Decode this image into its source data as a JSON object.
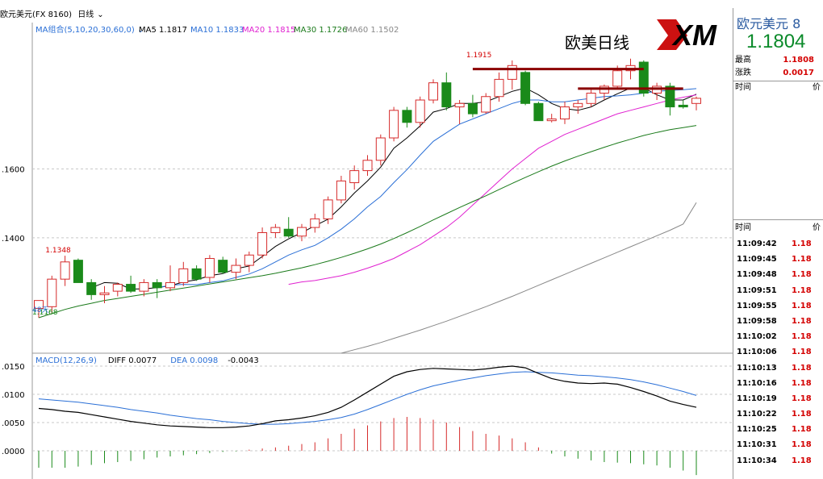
{
  "header": {
    "symbol": "欧元美元(FX 8160)",
    "period": "日线",
    "period_icon": "chevron-down"
  },
  "ma_legend": {
    "label": "MA组合(5,10,20,30,60,0)",
    "items": [
      {
        "name": "MA5",
        "value": "1.1817",
        "color": "#000000"
      },
      {
        "name": "MA10",
        "value": "1.1833",
        "color": "#2a6fd6"
      },
      {
        "name": "MA20",
        "value": "1.1815",
        "color": "#e020d0"
      },
      {
        "name": "MA30",
        "value": "1.1726",
        "color": "#1a7a1a"
      },
      {
        "name": "MA60",
        "value": "1.1502",
        "color": "#888888"
      }
    ]
  },
  "macd_legend": {
    "label": "MACD(12,26,9)",
    "diff": "DIFF 0.0077",
    "dea": "DEA 0.0098",
    "macd": "-0.0043"
  },
  "overlay_title": "欧美日线",
  "logo_text": "XM",
  "right_panel": {
    "title": "欧元美元 8",
    "price": "1.1804",
    "high_label": "最高",
    "high_value": "1.1808",
    "change_label": "涨跌",
    "change_value": "0.0017",
    "col_time": "时间",
    "col_price": "价",
    "ticks": [
      {
        "time": "11:09:42",
        "price": "1.18"
      },
      {
        "time": "11:09:45",
        "price": "1.18"
      },
      {
        "time": "11:09:48",
        "price": "1.18"
      },
      {
        "time": "11:09:51",
        "price": "1.18"
      },
      {
        "time": "11:09:55",
        "price": "1.18"
      },
      {
        "time": "11:09:58",
        "price": "1.18"
      },
      {
        "time": "11:10:02",
        "price": "1.18"
      },
      {
        "time": "11:10:06",
        "price": "1.18"
      },
      {
        "time": "11:10:13",
        "price": "1.18"
      },
      {
        "time": "11:10:16",
        "price": "1.18"
      },
      {
        "time": "11:10:19",
        "price": "1.18"
      },
      {
        "time": "11:10:22",
        "price": "1.18"
      },
      {
        "time": "11:10:25",
        "price": "1.18"
      },
      {
        "time": "11:10:31",
        "price": "1.18"
      },
      {
        "time": "11:10:34",
        "price": "1.18"
      }
    ]
  },
  "chart_data": {
    "type": "candlestick",
    "colors": {
      "up": "#d62b2b",
      "down": "#1a8a1a",
      "resistance": "#8b0000",
      "grid": "#c8c8c8"
    },
    "price_axis": {
      "ticks": [
        1.16,
        1.14
      ],
      "tick_labels": [
        ".1600",
        ".1400"
      ],
      "ylim": [
        1.1065,
        1.1985
      ]
    },
    "macd_axis": {
      "ticks": [
        0.015,
        0.01,
        0.005,
        0.0
      ],
      "tick_labels": [
        ".0150",
        ".0100",
        ".0050",
        ".0000"
      ],
      "ylim": [
        -0.005,
        0.017
      ]
    },
    "annotations": [
      {
        "text": "1.1348",
        "value": 1.1348,
        "index": 1
      },
      {
        "text": "1.1915",
        "value": 1.1915,
        "index": 33
      },
      {
        "text": "1.1168",
        "value": 1.1168,
        "index": 0
      },
      {
        "text": "48天",
        "value": 1.1175,
        "index": 0
      }
    ],
    "resistance_lines": [
      {
        "value": 1.189,
        "from_index": 33,
        "to_index": 46
      },
      {
        "value": 1.1833,
        "from_index": 41,
        "to_index": 49
      }
    ],
    "candles": [
      {
        "o": 1.1195,
        "h": 1.121,
        "l": 1.1168,
        "c": 1.1218
      },
      {
        "o": 1.12,
        "h": 1.129,
        "l": 1.118,
        "c": 1.128
      },
      {
        "o": 1.128,
        "h": 1.1348,
        "l": 1.126,
        "c": 1.133
      },
      {
        "o": 1.1335,
        "h": 1.134,
        "l": 1.127,
        "c": 1.127
      },
      {
        "o": 1.127,
        "h": 1.128,
        "l": 1.122,
        "c": 1.1235
      },
      {
        "o": 1.1235,
        "h": 1.126,
        "l": 1.121,
        "c": 1.124
      },
      {
        "o": 1.1245,
        "h": 1.127,
        "l": 1.123,
        "c": 1.1265
      },
      {
        "o": 1.1265,
        "h": 1.129,
        "l": 1.124,
        "c": 1.1245
      },
      {
        "o": 1.1245,
        "h": 1.128,
        "l": 1.123,
        "c": 1.127
      },
      {
        "o": 1.127,
        "h": 1.128,
        "l": 1.1225,
        "c": 1.1255
      },
      {
        "o": 1.1255,
        "h": 1.132,
        "l": 1.1245,
        "c": 1.127
      },
      {
        "o": 1.127,
        "h": 1.133,
        "l": 1.126,
        "c": 1.131
      },
      {
        "o": 1.131,
        "h": 1.132,
        "l": 1.1275,
        "c": 1.128
      },
      {
        "o": 1.1285,
        "h": 1.135,
        "l": 1.127,
        "c": 1.134
      },
      {
        "o": 1.1335,
        "h": 1.1345,
        "l": 1.1295,
        "c": 1.13
      },
      {
        "o": 1.13,
        "h": 1.134,
        "l": 1.128,
        "c": 1.132
      },
      {
        "o": 1.132,
        "h": 1.136,
        "l": 1.13,
        "c": 1.135
      },
      {
        "o": 1.135,
        "h": 1.143,
        "l": 1.134,
        "c": 1.1415
      },
      {
        "o": 1.1415,
        "h": 1.144,
        "l": 1.14,
        "c": 1.143
      },
      {
        "o": 1.1425,
        "h": 1.146,
        "l": 1.14,
        "c": 1.1405
      },
      {
        "o": 1.1405,
        "h": 1.144,
        "l": 1.139,
        "c": 1.143
      },
      {
        "o": 1.143,
        "h": 1.147,
        "l": 1.1415,
        "c": 1.1455
      },
      {
        "o": 1.1455,
        "h": 1.152,
        "l": 1.144,
        "c": 1.151
      },
      {
        "o": 1.151,
        "h": 1.158,
        "l": 1.15,
        "c": 1.1565
      },
      {
        "o": 1.156,
        "h": 1.161,
        "l": 1.154,
        "c": 1.1595
      },
      {
        "o": 1.1595,
        "h": 1.164,
        "l": 1.158,
        "c": 1.1625
      },
      {
        "o": 1.1625,
        "h": 1.17,
        "l": 1.161,
        "c": 1.169
      },
      {
        "o": 1.169,
        "h": 1.178,
        "l": 1.168,
        "c": 1.177
      },
      {
        "o": 1.177,
        "h": 1.178,
        "l": 1.172,
        "c": 1.1735
      },
      {
        "o": 1.1735,
        "h": 1.181,
        "l": 1.172,
        "c": 1.18
      },
      {
        "o": 1.18,
        "h": 1.186,
        "l": 1.179,
        "c": 1.185
      },
      {
        "o": 1.185,
        "h": 1.188,
        "l": 1.177,
        "c": 1.178
      },
      {
        "o": 1.178,
        "h": 1.18,
        "l": 1.173,
        "c": 1.179
      },
      {
        "o": 1.179,
        "h": 1.1815,
        "l": 1.175,
        "c": 1.176
      },
      {
        "o": 1.1765,
        "h": 1.182,
        "l": 1.176,
        "c": 1.181
      },
      {
        "o": 1.181,
        "h": 1.188,
        "l": 1.1795,
        "c": 1.186
      },
      {
        "o": 1.186,
        "h": 1.1915,
        "l": 1.183,
        "c": 1.19
      },
      {
        "o": 1.188,
        "h": 1.1885,
        "l": 1.1785,
        "c": 1.179
      },
      {
        "o": 1.179,
        "h": 1.1795,
        "l": 1.174,
        "c": 1.174
      },
      {
        "o": 1.174,
        "h": 1.176,
        "l": 1.1735,
        "c": 1.1745
      },
      {
        "o": 1.1745,
        "h": 1.1795,
        "l": 1.173,
        "c": 1.178
      },
      {
        "o": 1.178,
        "h": 1.18,
        "l": 1.176,
        "c": 1.179
      },
      {
        "o": 1.179,
        "h": 1.183,
        "l": 1.178,
        "c": 1.182
      },
      {
        "o": 1.182,
        "h": 1.1845,
        "l": 1.18,
        "c": 1.184
      },
      {
        "o": 1.184,
        "h": 1.19,
        "l": 1.1835,
        "c": 1.1885
      },
      {
        "o": 1.1885,
        "h": 1.192,
        "l": 1.186,
        "c": 1.19
      },
      {
        "o": 1.191,
        "h": 1.1915,
        "l": 1.181,
        "c": 1.182
      },
      {
        "o": 1.182,
        "h": 1.185,
        "l": 1.18,
        "c": 1.184
      },
      {
        "o": 1.184,
        "h": 1.185,
        "l": 1.1755,
        "c": 1.178
      },
      {
        "o": 1.1785,
        "h": 1.18,
        "l": 1.1775,
        "c": 1.178
      },
      {
        "o": 1.179,
        "h": 1.181,
        "l": 1.177,
        "c": 1.1805
      }
    ],
    "ma_series": [
      {
        "name": "MA5",
        "color": "#000000",
        "values": [
          null,
          null,
          null,
          null,
          1.1255,
          1.127,
          1.1268,
          1.1251,
          1.1252,
          1.1255,
          1.1261,
          1.1272,
          1.1278,
          1.129,
          1.1296,
          1.131,
          1.1318,
          1.1346,
          1.1375,
          1.1397,
          1.1415,
          1.1435,
          1.1454,
          1.149,
          1.153,
          1.1565,
          1.1605,
          1.166,
          1.169,
          1.1725,
          1.1765,
          1.1775,
          1.179,
          1.179,
          1.1795,
          1.181,
          1.1825,
          1.1835,
          1.1815,
          1.179,
          1.1775,
          1.177,
          1.178,
          1.18,
          1.1818,
          1.1835,
          1.1835,
          1.1815,
          1.18,
          1.18,
          1.1817
        ]
      },
      {
        "name": "MA10",
        "color": "#2a6fd6",
        "values": [
          null,
          null,
          null,
          null,
          null,
          null,
          null,
          null,
          null,
          1.1255,
          1.1262,
          1.1265,
          1.1264,
          1.127,
          1.1275,
          1.1285,
          1.1295,
          1.131,
          1.133,
          1.135,
          1.1365,
          1.1378,
          1.14,
          1.1425,
          1.1455,
          1.149,
          1.152,
          1.156,
          1.1598,
          1.164,
          1.168,
          1.1705,
          1.173,
          1.1745,
          1.176,
          1.1775,
          1.179,
          1.18,
          1.18,
          1.1795,
          1.1795,
          1.18,
          1.1805,
          1.181,
          1.1812,
          1.1815,
          1.182,
          1.1825,
          1.1828,
          1.183,
          1.1833
        ]
      },
      {
        "name": "MA20",
        "color": "#e020d0",
        "values": [
          null,
          null,
          null,
          null,
          null,
          null,
          null,
          null,
          null,
          null,
          null,
          null,
          null,
          null,
          null,
          null,
          null,
          null,
          null,
          1.1265,
          1.1272,
          1.1276,
          1.1283,
          1.129,
          1.13,
          1.1312,
          1.1325,
          1.134,
          1.136,
          1.138,
          1.1405,
          1.143,
          1.146,
          1.1495,
          1.153,
          1.1565,
          1.16,
          1.163,
          1.166,
          1.168,
          1.17,
          1.1715,
          1.173,
          1.1745,
          1.176,
          1.177,
          1.178,
          1.179,
          1.18,
          1.1808,
          1.1815
        ]
      },
      {
        "name": "MA30",
        "color": "#1a7a1a",
        "values": [
          1.1168,
          1.118,
          1.1192,
          1.1202,
          1.121,
          1.1218,
          1.1224,
          1.123,
          1.1236,
          1.1242,
          1.1248,
          1.1254,
          1.126,
          1.1266,
          1.1272,
          1.1278,
          1.1284,
          1.129,
          1.1297,
          1.1305,
          1.1313,
          1.1322,
          1.1332,
          1.1343,
          1.1355,
          1.1368,
          1.1382,
          1.1398,
          1.1415,
          1.1433,
          1.1452,
          1.147,
          1.1488,
          1.1505,
          1.1522,
          1.154,
          1.1558,
          1.1575,
          1.1592,
          1.1608,
          1.1623,
          1.1637,
          1.165,
          1.1663,
          1.1675,
          1.1686,
          1.1697,
          1.1706,
          1.1714,
          1.172,
          1.1726
        ]
      },
      {
        "name": "MA60",
        "color": "#888888",
        "values": [
          null,
          null,
          null,
          null,
          null,
          null,
          null,
          null,
          null,
          null,
          null,
          null,
          null,
          null,
          null,
          null,
          null,
          null,
          null,
          null,
          null,
          null,
          null,
          1.1065,
          1.1075,
          1.1085,
          1.1096,
          1.1108,
          1.112,
          1.1132,
          1.1145,
          1.1158,
          1.1172,
          1.1186,
          1.12,
          1.1215,
          1.123,
          1.1246,
          1.1262,
          1.1278,
          1.1294,
          1.131,
          1.1326,
          1.1342,
          1.1358,
          1.1374,
          1.139,
          1.1406,
          1.1422,
          1.144,
          1.1502
        ]
      }
    ],
    "macd": {
      "diff": [
        0.0075,
        0.0073,
        0.007,
        0.0068,
        0.0064,
        0.006,
        0.0056,
        0.0052,
        0.0049,
        0.0046,
        0.0044,
        0.0043,
        0.0042,
        0.0041,
        0.0041,
        0.0042,
        0.0044,
        0.0048,
        0.0053,
        0.0055,
        0.0058,
        0.0062,
        0.0068,
        0.0077,
        0.009,
        0.0104,
        0.0118,
        0.0132,
        0.014,
        0.0144,
        0.0146,
        0.0145,
        0.0144,
        0.0143,
        0.0145,
        0.0148,
        0.015,
        0.0147,
        0.0137,
        0.0128,
        0.0123,
        0.012,
        0.0119,
        0.012,
        0.0118,
        0.0112,
        0.0105,
        0.0097,
        0.0088,
        0.0082,
        0.0077
      ],
      "dea": [
        0.0092,
        0.009,
        0.0088,
        0.0086,
        0.0083,
        0.008,
        0.0077,
        0.0073,
        0.007,
        0.0067,
        0.0063,
        0.006,
        0.0057,
        0.0055,
        0.0052,
        0.005,
        0.0048,
        0.0047,
        0.0047,
        0.0048,
        0.005,
        0.0052,
        0.0055,
        0.0059,
        0.0065,
        0.0073,
        0.0082,
        0.0091,
        0.01,
        0.0108,
        0.0115,
        0.012,
        0.0125,
        0.0129,
        0.0133,
        0.0136,
        0.0139,
        0.014,
        0.0139,
        0.0138,
        0.0136,
        0.0134,
        0.0133,
        0.0131,
        0.0129,
        0.0126,
        0.0122,
        0.0117,
        0.0111,
        0.0105,
        0.0098
      ],
      "hist": [
        -0.003,
        -0.003,
        -0.003,
        -0.0028,
        -0.0025,
        -0.0022,
        -0.002,
        -0.0018,
        -0.0015,
        -0.0012,
        -0.001,
        -0.0008,
        -0.0006,
        -0.0004,
        -0.0002,
        -0.0001,
        0.0002,
        0.0004,
        0.0006,
        0.0009,
        0.0012,
        0.0015,
        0.0022,
        0.003,
        0.0039,
        0.0045,
        0.0052,
        0.0058,
        0.006,
        0.0058,
        0.0055,
        0.005,
        0.0042,
        0.0035,
        0.003,
        0.0027,
        0.0022,
        0.0015,
        0.0006,
        -0.0005,
        -0.001,
        -0.0014,
        -0.0017,
        -0.002,
        -0.0021,
        -0.0022,
        -0.0024,
        -0.0026,
        -0.003,
        -0.0035,
        -0.0043
      ]
    }
  }
}
